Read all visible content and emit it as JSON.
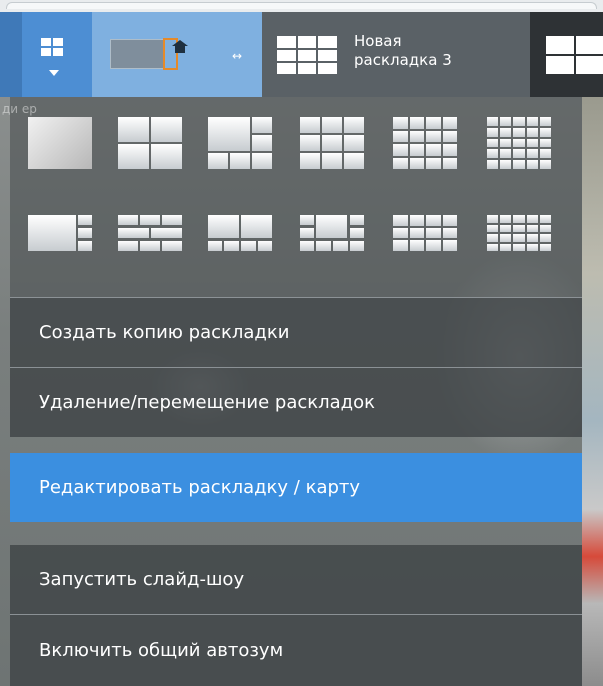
{
  "toolbar": {
    "layout_tab": {
      "title_line1": "Новая",
      "title_line2": "раскладка 3"
    },
    "resize_glyph": "↔"
  },
  "layout_grid": {
    "row1": [
      "1x1",
      "2x2",
      "1+5",
      "3x3",
      "4x4",
      "5x5"
    ],
    "row2": [
      "1+side",
      "2+6",
      "wide+small",
      "mixed",
      "3x4",
      "4x5"
    ]
  },
  "menu": {
    "items": [
      {
        "label": "Создать копию раскладки",
        "active": false
      },
      {
        "label": "Удаление/перемещение раскладок",
        "active": false
      },
      {
        "label": "Редактировать раскладку / карту",
        "active": true
      },
      {
        "label": "Запустить слайд-шоу",
        "active": false
      },
      {
        "label": "Включить общий автозум",
        "active": false
      }
    ]
  },
  "background": {
    "ghost_text": "ди   ер"
  },
  "colors": {
    "accent": "#3b8fe0",
    "toolbar_active": "#4d8ed3",
    "menu_bg": "#404447"
  }
}
